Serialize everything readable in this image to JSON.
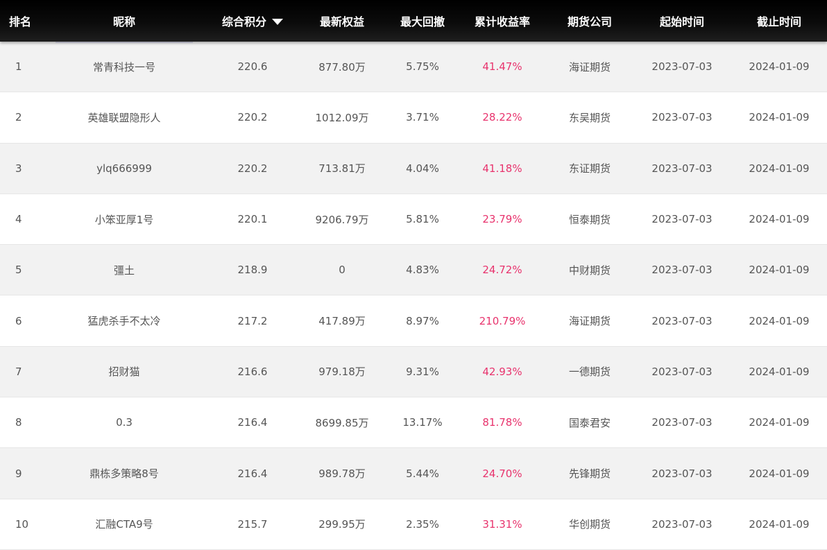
{
  "table": {
    "headers": [
      "排名",
      "昵称",
      "综合积分",
      "最新权益",
      "最大回撤",
      "累计收益率",
      "期货公司",
      "起始时间",
      "截止时间"
    ],
    "sorted_column": "综合积分",
    "sort_icon": "caret-down-icon",
    "colors": {
      "header_bg": "#000000",
      "rate_text": "#e8336d",
      "row_alt": "#f2f2f2"
    },
    "rows": [
      [
        "1",
        "常青科技一号",
        "220.6",
        "877.80万",
        "5.75%",
        "41.47%",
        "海证期货",
        "2023-07-03",
        "2024-01-09"
      ],
      [
        "2",
        "英雄联盟隐形人",
        "220.2",
        "1012.09万",
        "3.71%",
        "28.22%",
        "东吴期货",
        "2023-07-03",
        "2024-01-09"
      ],
      [
        "3",
        "ylq666999",
        "220.2",
        "713.81万",
        "4.04%",
        "41.18%",
        "东证期货",
        "2023-07-03",
        "2024-01-09"
      ],
      [
        "4",
        "小笨亚厚1号",
        "220.1",
        "9206.79万",
        "5.81%",
        "23.79%",
        "恒泰期货",
        "2023-07-03",
        "2024-01-09"
      ],
      [
        "5",
        "彊土",
        "218.9",
        "0",
        "4.83%",
        "24.72%",
        "中财期货",
        "2023-07-03",
        "2024-01-09"
      ],
      [
        "6",
        "猛虎杀手不太冷",
        "217.2",
        "417.89万",
        "8.97%",
        "210.79%",
        "海证期货",
        "2023-07-03",
        "2024-01-09"
      ],
      [
        "7",
        "招财猫",
        "216.6",
        "979.18万",
        "9.31%",
        "42.93%",
        "一德期货",
        "2023-07-03",
        "2024-01-09"
      ],
      [
        "8",
        "0.3",
        "216.4",
        "8699.85万",
        "13.17%",
        "81.78%",
        "国泰君安",
        "2023-07-03",
        "2024-01-09"
      ],
      [
        "9",
        "鼎栋多策略8号",
        "216.4",
        "989.78万",
        "5.44%",
        "24.70%",
        "先锋期货",
        "2023-07-03",
        "2024-01-09"
      ],
      [
        "10",
        "汇融CTA9号",
        "215.7",
        "299.95万",
        "2.35%",
        "31.31%",
        "华创期货",
        "2023-07-03",
        "2024-01-09"
      ]
    ]
  }
}
